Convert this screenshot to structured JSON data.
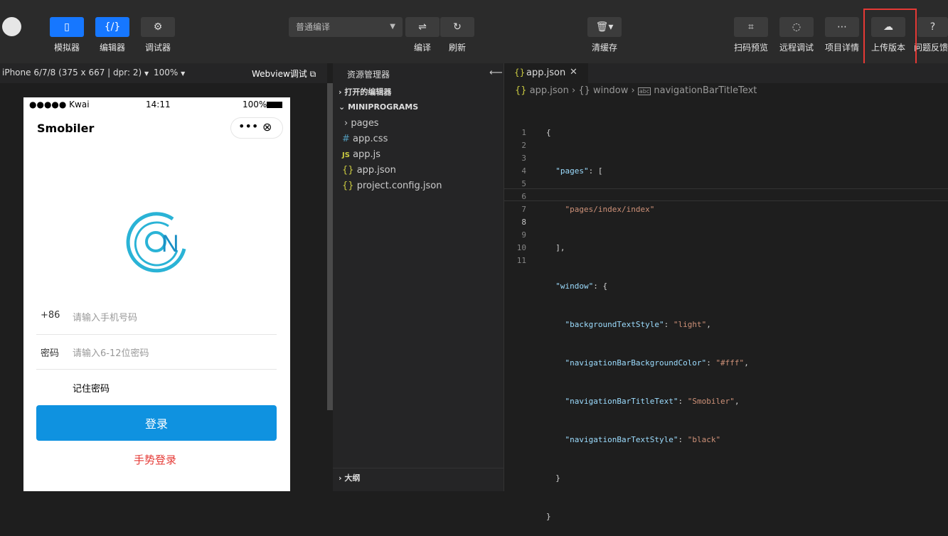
{
  "toolbar": {
    "simulator_label": "模拟器",
    "editor_label": "编辑器",
    "debugger_label": "调试器",
    "compile_mode": "普通编译",
    "compile_label": "编译",
    "refresh_label": "刷新",
    "clear_cache_label": "清缓存",
    "scan_preview_label": "扫码预览",
    "remote_debug_label": "远程调试",
    "project_details_label": "项目详情",
    "upload_label": "上传版本",
    "feedback_label": "问题反馈"
  },
  "simulator": {
    "device": "iPhone 6/7/8 (375 x 667 | dpr: 2)",
    "zoom": "100%",
    "webview_debug": "Webview调试",
    "status_carrier": "●●●●● Kwai",
    "status_time": "14:11",
    "status_battery": "100%",
    "nav_title": "Smobiler",
    "country_code": "+86",
    "phone_placeholder": "请输入手机号码",
    "password_label": "密码",
    "password_placeholder": "请输入6-12位密码",
    "remember_label": "记住密码",
    "login_button": "登录",
    "gesture_login": "手势登录"
  },
  "explorer": {
    "title": "资源管理器",
    "open_editors": "打开的编辑器",
    "project": "MINIPROGRAMS",
    "items": [
      {
        "icon": "folder",
        "label": "pages"
      },
      {
        "icon": "#",
        "label": "app.css"
      },
      {
        "icon": "JS",
        "label": "app.js"
      },
      {
        "icon": "{}",
        "label": "app.json"
      },
      {
        "icon": "{}",
        "label": "project.config.json"
      }
    ],
    "outline": "大纲"
  },
  "editor": {
    "tab": "app.json",
    "breadcrumb": [
      "app.json",
      "window",
      "navigationBarTitleText"
    ],
    "lines": [
      "{",
      "  \"pages\": [",
      "    \"pages/index/index\"",
      "  ],",
      "  \"window\": {",
      "    \"backgroundTextStyle\": \"light\",",
      "    \"navigationBarBackgroundColor\": \"#fff\",",
      "    \"navigationBarTitleText\": \"Smobiler\",",
      "    \"navigationBarTextStyle\": \"black\"",
      "  }",
      "}"
    ]
  },
  "colors": {
    "accent": "#1677ff",
    "login": "#0f92e0",
    "gesture": "#e53935",
    "highlight": "#e53935"
  }
}
